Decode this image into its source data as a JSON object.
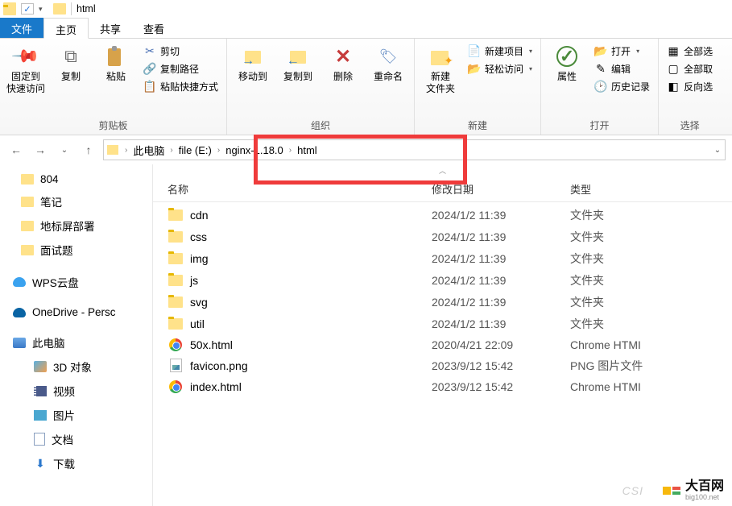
{
  "window": {
    "title": "html"
  },
  "tabs": {
    "file": "文件",
    "home": "主页",
    "share": "共享",
    "view": "查看"
  },
  "ribbon": {
    "clipboard": {
      "pin": "固定到\n快速访问",
      "copy": "复制",
      "paste": "粘贴",
      "cut": "剪切",
      "copypath": "复制路径",
      "pasteshortcut": "粘贴快捷方式",
      "group": "剪贴板"
    },
    "organize": {
      "moveto": "移动到",
      "copyto": "复制到",
      "delete": "删除",
      "rename": "重命名",
      "group": "组织"
    },
    "new": {
      "newfolder": "新建\n文件夹",
      "newitem": "新建项目",
      "easyaccess": "轻松访问",
      "group": "新建"
    },
    "open": {
      "properties": "属性",
      "open": "打开",
      "edit": "编辑",
      "history": "历史记录",
      "group": "打开"
    },
    "select": {
      "selectall": "全部选",
      "selectnone": "全部取",
      "invert": "反向选",
      "group": "选择"
    }
  },
  "breadcrumb": [
    "此电脑",
    "file (E:)",
    "nginx-1.18.0",
    "html"
  ],
  "columns": {
    "name": "名称",
    "date": "修改日期",
    "type": "类型"
  },
  "sidebar": {
    "quick": [
      "804",
      "笔记",
      "地标屏部署",
      "面试题"
    ],
    "wps": "WPS云盘",
    "onedrive": "OneDrive - Persc",
    "thispc": "此电脑",
    "pc_children": [
      "3D 对象",
      "视频",
      "图片",
      "文档",
      "下载"
    ]
  },
  "files_type": {
    "folder": "文件夹",
    "chromehtml": "Chrome HTMI",
    "png": "PNG 图片文件"
  },
  "files": [
    {
      "icon": "folder",
      "name": "cdn",
      "date": "2024/1/2 11:39",
      "typekey": "folder"
    },
    {
      "icon": "folder",
      "name": "css",
      "date": "2024/1/2 11:39",
      "typekey": "folder"
    },
    {
      "icon": "folder",
      "name": "img",
      "date": "2024/1/2 11:39",
      "typekey": "folder"
    },
    {
      "icon": "folder",
      "name": "js",
      "date": "2024/1/2 11:39",
      "typekey": "folder"
    },
    {
      "icon": "folder",
      "name": "svg",
      "date": "2024/1/2 11:39",
      "typekey": "folder"
    },
    {
      "icon": "folder",
      "name": "util",
      "date": "2024/1/2 11:39",
      "typekey": "folder"
    },
    {
      "icon": "chrome",
      "name": "50x.html",
      "date": "2020/4/21 22:09",
      "typekey": "chromehtml"
    },
    {
      "icon": "png",
      "name": "favicon.png",
      "date": "2023/9/12 15:42",
      "typekey": "png"
    },
    {
      "icon": "chrome",
      "name": "index.html",
      "date": "2023/9/12 15:42",
      "typekey": "chromehtml"
    }
  ],
  "watermark": {
    "csdn": "CSI",
    "brand": "大百网",
    "domain": "big100.net"
  }
}
